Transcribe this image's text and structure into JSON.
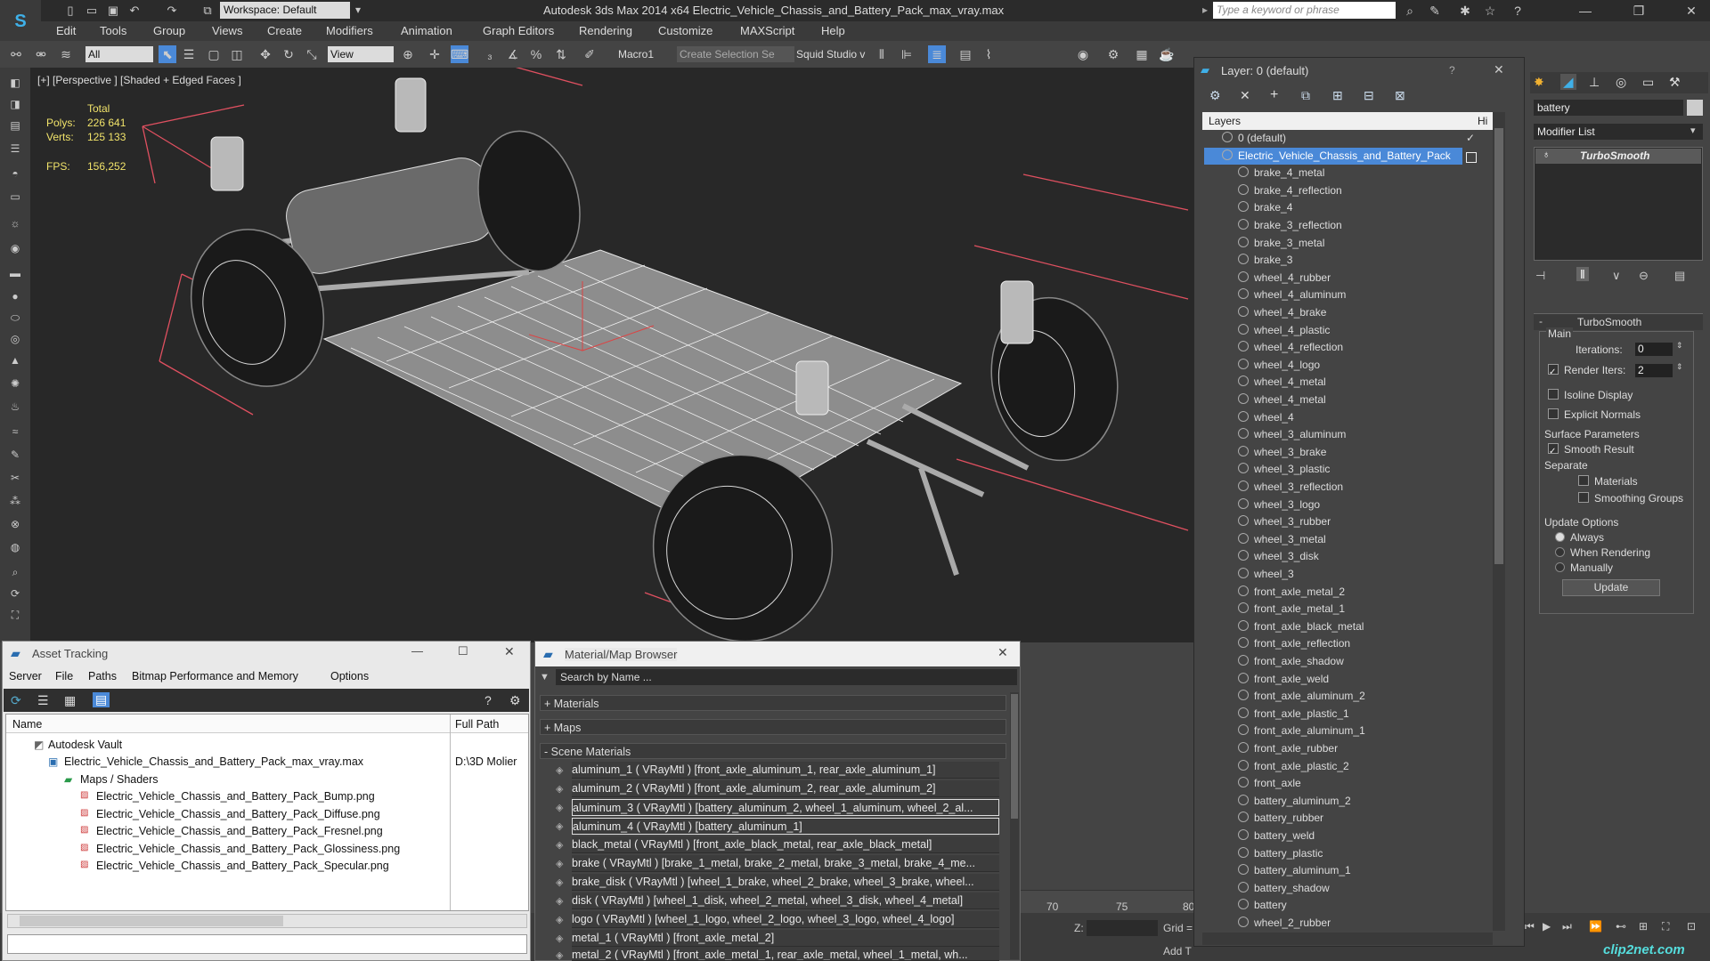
{
  "app": {
    "title": "Autodesk 3ds Max  2014 x64     Electric_Vehicle_Chassis_and_Battery_Pack_max_vray.max",
    "workspace": "Workspace: Default",
    "search_placeholder": "Type a keyword or phrase"
  },
  "menu": [
    "Edit",
    "Tools",
    "Group",
    "Views",
    "Create",
    "Modifiers",
    "Animation",
    "Graph Editors",
    "Rendering",
    "Customize",
    "MAXScript",
    "Help"
  ],
  "toolbar": {
    "selection_filter": "All",
    "ref_coord": "View",
    "macro_label": "Macro1",
    "named_selection": "Create Selection Se",
    "squid_label": "Squid Studio v"
  },
  "viewport": {
    "label": "[+] [Perspective ] [Shaded + Edged Faces ]",
    "stats": {
      "total_label": "Total",
      "polys_label": "Polys:",
      "polys_value": "226 641",
      "verts_label": "Verts:",
      "verts_value": "125 133",
      "fps_label": "FPS:",
      "fps_value": "156,252"
    }
  },
  "asset_tracking": {
    "title": "Asset Tracking",
    "menu": [
      "Server",
      "File",
      "Paths",
      "Bitmap Performance and Memory",
      "Options"
    ],
    "columns": {
      "name": "Name",
      "path": "Full Path"
    },
    "rows": [
      {
        "name": "Autodesk Vault",
        "path": ""
      },
      {
        "name": "Electric_Vehicle_Chassis_and_Battery_Pack_max_vray.max",
        "path": "D:\\3D Molier"
      },
      {
        "name": "Maps / Shaders",
        "path": ""
      },
      {
        "name": "Electric_Vehicle_Chassis_and_Battery_Pack_Bump.png",
        "path": ""
      },
      {
        "name": "Electric_Vehicle_Chassis_and_Battery_Pack_Diffuse.png",
        "path": ""
      },
      {
        "name": "Electric_Vehicle_Chassis_and_Battery_Pack_Fresnel.png",
        "path": ""
      },
      {
        "name": "Electric_Vehicle_Chassis_and_Battery_Pack_Glossiness.png",
        "path": ""
      },
      {
        "name": "Electric_Vehicle_Chassis_and_Battery_Pack_Specular.png",
        "path": ""
      }
    ]
  },
  "material_browser": {
    "title": "Material/Map Browser",
    "search_placeholder": "Search by Name ...",
    "groups": [
      "+ Materials",
      "+ Maps",
      "- Scene Materials"
    ],
    "materials": [
      "aluminum_1  ( VRayMtl )  [front_axle_aluminum_1, rear_axle_aluminum_1]",
      "aluminum_2  ( VRayMtl )  [front_axle_aluminum_2, rear_axle_aluminum_2]",
      "aluminum_3  ( VRayMtl )  [battery_aluminum_2, wheel_1_aluminum, wheel_2_al...",
      "aluminum_4  ( VRayMtl )  [battery_aluminum_1]",
      "black_metal  ( VRayMtl )  [front_axle_black_metal, rear_axle_black_metal]",
      "brake  ( VRayMtl )  [brake_1_metal, brake_2_metal, brake_3_metal, brake_4_me...",
      "brake_disk  ( VRayMtl )  [wheel_1_brake, wheel_2_brake, wheel_3_brake, wheel...",
      "disk  ( VRayMtl )  [wheel_1_disk, wheel_2_metal, wheel_3_disk, wheel_4_metal]",
      "logo  ( VRayMtl )  [wheel_1_logo, wheel_2_logo, wheel_3_logo, wheel_4_logo]",
      "metal_1  ( VRayMtl )  [front_axle_metal_2]",
      "metal_2  ( VRayMtl )  [front_axle_metal_1, rear_axle_metal, wheel_1_metal, wh..."
    ]
  },
  "layer_explorer": {
    "title": "Layer: 0 (default)",
    "column": "Layers",
    "column2": "Hi",
    "layers": [
      "0 (default)",
      "Electric_Vehicle_Chassis_and_Battery_Pack",
      "brake_4_metal",
      "brake_4_reflection",
      "brake_4",
      "brake_3_reflection",
      "brake_3_metal",
      "brake_3",
      "wheel_4_rubber",
      "wheel_4_aluminum",
      "wheel_4_brake",
      "wheel_4_plastic",
      "wheel_4_reflection",
      "wheel_4_logo",
      "wheel_4_metal",
      "wheel_4_metal",
      "wheel_4",
      "wheel_3_aluminum",
      "wheel_3_brake",
      "wheel_3_plastic",
      "wheel_3_reflection",
      "wheel_3_logo",
      "wheel_3_rubber",
      "wheel_3_metal",
      "wheel_3_disk",
      "wheel_3",
      "front_axle_metal_2",
      "front_axle_metal_1",
      "front_axle_black_metal",
      "front_axle_reflection",
      "front_axle_shadow",
      "front_axle_weld",
      "front_axle_aluminum_2",
      "front_axle_plastic_1",
      "front_axle_aluminum_1",
      "front_axle_rubber",
      "front_axle_plastic_2",
      "front_axle",
      "battery_aluminum_2",
      "battery_rubber",
      "battery_weld",
      "battery_plastic",
      "battery_aluminum_1",
      "battery_shadow",
      "battery",
      "wheel_2_rubber"
    ]
  },
  "command_panel": {
    "object_name": "battery",
    "modifier_list": "Modifier List",
    "stack_item": "TurboSmooth",
    "rollout_title": "TurboSmooth",
    "main_label": "Main",
    "iterations_label": "Iterations:",
    "iterations_value": "0",
    "render_iters_label": "Render Iters:",
    "render_iters_value": "2",
    "isoline": "Isoline Display",
    "explicit_normals": "Explicit Normals",
    "surface_params": "Surface Parameters",
    "smooth_result": "Smooth Result",
    "separate": "Separate",
    "materials": "Materials",
    "smoothing_groups": "Smoothing Groups",
    "update_options": "Update Options",
    "always": "Always",
    "when_rendering": "When Rendering",
    "manually": "Manually",
    "update_button": "Update"
  },
  "timeline": {
    "ticks": [
      "70",
      "75",
      "80"
    ]
  },
  "status": {
    "z_label": "Z:",
    "grid_label": "Grid =",
    "add_time": "Add T"
  },
  "watermark": "clip2net.com",
  "colors": {
    "selection": "#4a89d8",
    "stats_text": "#f1e36a",
    "viewport_bg": "#282828"
  }
}
